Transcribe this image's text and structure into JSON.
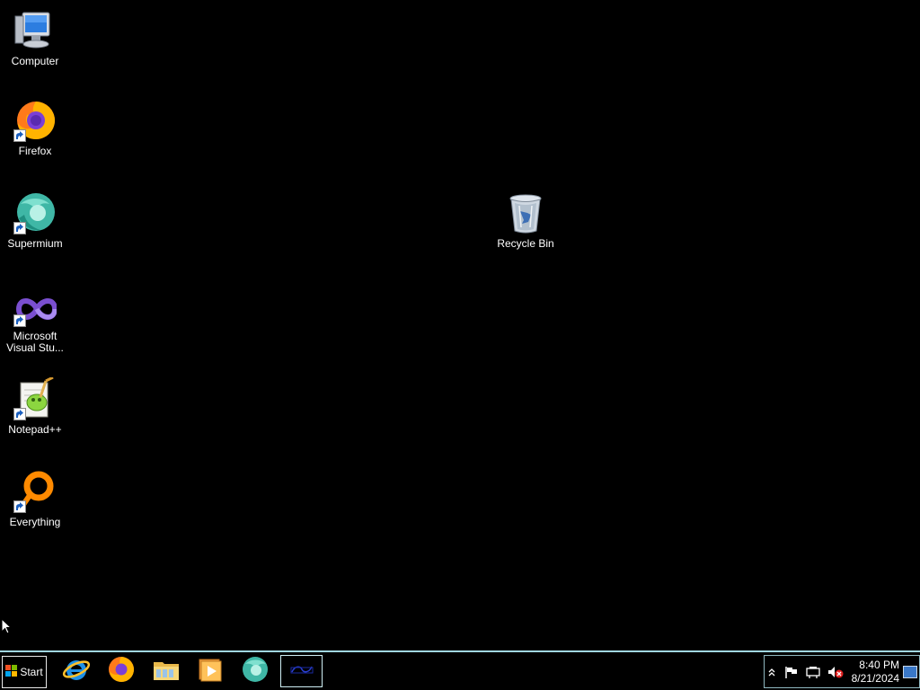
{
  "desktop": {
    "icons": [
      {
        "label": "Computer",
        "icon": "computer-icon",
        "shortcut": false
      },
      {
        "label": "Firefox",
        "icon": "firefox-icon",
        "shortcut": true
      },
      {
        "label": "Supermium",
        "icon": "supermium-icon",
        "shortcut": true
      },
      {
        "label": "Microsoft Visual Stu...",
        "icon": "visual-studio-icon",
        "shortcut": true
      },
      {
        "label": "Notepad++",
        "icon": "notepad-plus-plus-icon",
        "shortcut": true
      },
      {
        "label": "Everything",
        "icon": "everything-icon",
        "shortcut": true
      },
      {
        "label": "Recycle Bin",
        "icon": "recycle-bin-icon",
        "shortcut": false
      }
    ]
  },
  "taskbar": {
    "start_label": "Start",
    "pinned": [
      {
        "icon": "internet-explorer-icon"
      },
      {
        "icon": "firefox-icon"
      },
      {
        "icon": "file-explorer-icon"
      },
      {
        "icon": "media-player-icon"
      },
      {
        "icon": "supermium-icon"
      },
      {
        "icon": "active-window-icon",
        "active": true
      }
    ],
    "tray": {
      "icons": [
        "show-hidden-icons-chevron",
        "action-center-flag-icon",
        "network-icon",
        "volume-muted-icon"
      ],
      "time": "8:40 PM",
      "date": "8/21/2024"
    }
  },
  "colors": {
    "desktop_bg": "#000000",
    "taskbar_border": "#9fd6e0",
    "text": "#ffffff"
  }
}
